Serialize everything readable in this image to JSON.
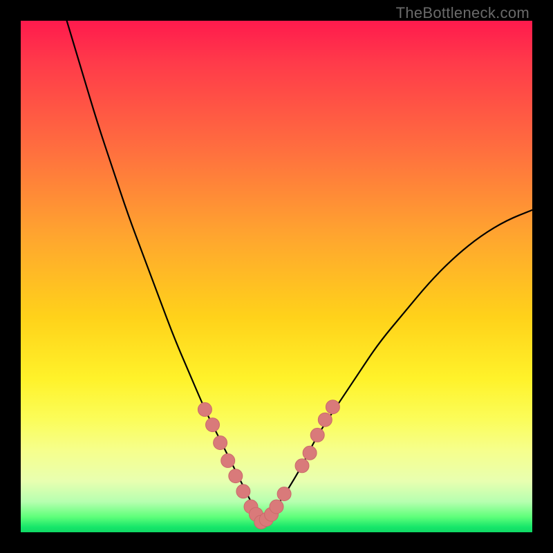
{
  "watermark": "TheBottleneck.com",
  "colors": {
    "frame": "#000000",
    "curve": "#000000",
    "marker_fill": "#d97a7a",
    "marker_stroke": "#c96a6a",
    "gradient_top": "#ff1a4d",
    "gradient_mid": "#ffd21a",
    "gradient_bottom": "#10d965"
  },
  "chart_data": {
    "type": "line",
    "title": "",
    "xlabel": "",
    "ylabel": "",
    "xlim": [
      0,
      100
    ],
    "ylim": [
      0,
      100
    ],
    "note": "Axes are unlabeled in source; x and y expressed as 0–100 percent of plot area (x left→right, y bottom→top). Curve is a V-shaped bottleneck profile with minimum near x≈47.",
    "series": [
      {
        "name": "bottleneck-curve",
        "x": [
          9,
          12,
          15,
          18,
          21,
          24,
          27,
          30,
          33,
          36,
          38,
          40,
          42,
          44,
          46,
          47,
          48,
          50,
          52,
          55,
          58,
          62,
          66,
          70,
          75,
          80,
          85,
          90,
          95,
          100
        ],
        "y": [
          100,
          90,
          80,
          71,
          62,
          54,
          46,
          38,
          31,
          24,
          20,
          16,
          12,
          8,
          4,
          2,
          3,
          5,
          8,
          13,
          19,
          25,
          31,
          37,
          43,
          49,
          54,
          58,
          61,
          63
        ]
      }
    ],
    "markers": {
      "name": "highlight-dots",
      "note": "Salmon circular markers clustered near the valley on both branches.",
      "points": [
        {
          "x": 36,
          "y": 24
        },
        {
          "x": 37.5,
          "y": 21
        },
        {
          "x": 39,
          "y": 17.5
        },
        {
          "x": 40.5,
          "y": 14
        },
        {
          "x": 42,
          "y": 11
        },
        {
          "x": 43.5,
          "y": 8
        },
        {
          "x": 45,
          "y": 5
        },
        {
          "x": 46,
          "y": 3.5
        },
        {
          "x": 47,
          "y": 2
        },
        {
          "x": 48,
          "y": 2.5
        },
        {
          "x": 49,
          "y": 3.5
        },
        {
          "x": 50,
          "y": 5
        },
        {
          "x": 51.5,
          "y": 7.5
        },
        {
          "x": 55,
          "y": 13
        },
        {
          "x": 56.5,
          "y": 15.5
        },
        {
          "x": 58,
          "y": 19
        },
        {
          "x": 59.5,
          "y": 22
        },
        {
          "x": 61,
          "y": 24.5
        }
      ]
    }
  }
}
